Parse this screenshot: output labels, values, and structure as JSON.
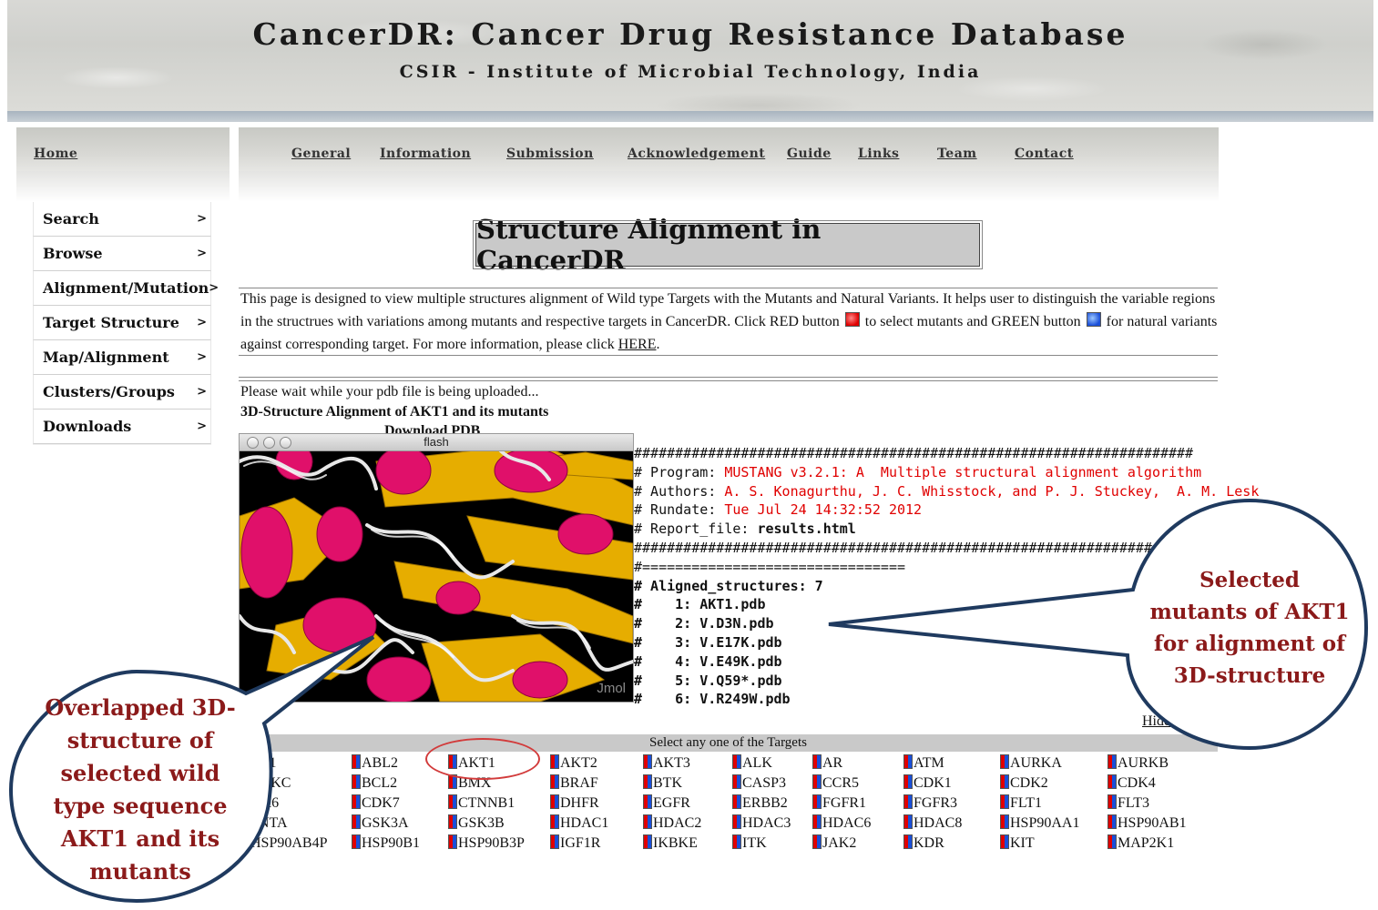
{
  "header": {
    "title": "CancerDR: Cancer Drug Resistance Database",
    "subtitle": "CSIR - Institute of Microbial Technology, India"
  },
  "nav": {
    "home": "Home",
    "links": [
      "General",
      "Information",
      "Submission",
      "Acknowledgement",
      "Guide",
      "Links",
      "Team",
      "Contact"
    ]
  },
  "sidebar": {
    "arrow": ">",
    "items": [
      "Search",
      "Browse",
      "Alignment/Mutation",
      "Target Structure",
      "Map/Alignment",
      "Clusters/Groups",
      "Downloads"
    ]
  },
  "main": {
    "heading": "Structure Alignment in CancerDR",
    "intro_1": "This page is designed to view multiple structures alignment of Wild type Targets with the Mutants and Natural Variants. It helps user to distinguish the variable regions in the structrues with variations among mutants and respective targets in CancerDR. Click RED button",
    "intro_2": "to select mutants and GREEN button",
    "intro_3": "for natural variants against corresponding target. For more information, please click",
    "here_link": "HERE",
    "intro_end": ".",
    "wait_text": "Please wait while your pdb file is being uploaded...",
    "alignment_title": "3D-Structure Alignment of AKT1 and its mutants",
    "download_pdb": "Download PDB",
    "hide_link": "Hide"
  },
  "flash_window": {
    "title": "flash",
    "jmol_label": "Jmol"
  },
  "mustang": {
    "hash_line": "####################################################################",
    "eq_line": "#===================================================================",
    "program_label": "# Program: ",
    "program_value": "MUSTANG v3.2.1: A  Multiple structural alignment algorithm",
    "authors_label": "# Authors: ",
    "authors_value": "A. S. Konagurthu, J. C. Whisstock, and P. J. Stuckey,  A. M. Lesk",
    "rundate_label": "# Rundate: ",
    "rundate_value": "Tue Jul 24 14:32:52 2012",
    "report_label": "# Report_file: ",
    "report_value": "results.html",
    "eq_short": "#================================",
    "aligned_label": "# Aligned_structures: 7",
    "structures": [
      "#    1: AKT1.pdb",
      "#    2: V.D3N.pdb",
      "#    3: V.E17K.pdb",
      "#    4: V.E49K.pdb",
      "#    5: V.Q59*.pdb",
      "#    6: V.R249W.pdb"
    ]
  },
  "targets": {
    "bar_label": "Select any one of the Targets",
    "rows": [
      [
        "BL1",
        "ABL2",
        "AKT1",
        "AKT2",
        "AKT3",
        "ALK",
        "AR",
        "ATM",
        "AURKA",
        "AURKB"
      ],
      [
        "URKC",
        "BCL2",
        "BMX",
        "BRAF",
        "BTK",
        "CASP3",
        "CCR5",
        "CDK1",
        "CDK2",
        "CDK4"
      ],
      [
        "DK6",
        "CDK7",
        "CTNNB1",
        "DHFR",
        "EGFR",
        "ERBB2",
        "FGFR1",
        "FGFR3",
        "FLT1",
        "FLT3"
      ],
      [
        "FNTA",
        "GSK3A",
        "GSK3B",
        "HDAC1",
        "HDAC2",
        "HDAC3",
        "HDAC6",
        "HDAC8",
        "HSP90AA1",
        "HSP90AB1"
      ],
      [
        "HSP90AB4P",
        "HSP90B1",
        "HSP90B3P",
        "IGF1R",
        "IKBKE",
        "ITK",
        "JAK2",
        "KDR",
        "KIT",
        "MAP2K1"
      ]
    ]
  },
  "callouts": {
    "mutants_text": "Selected mutants of AKT1 for alignment of 3D-structure",
    "structure_text": "Overlapped 3D-structure of selected wild type sequence AKT1 and its mutants"
  },
  "colors": {
    "callout_text": "#8b1a1a",
    "callout_border": "#1f3a5f",
    "red_text": "#e00000",
    "helix": "#e0106a",
    "sheet": "#e6ad00"
  }
}
